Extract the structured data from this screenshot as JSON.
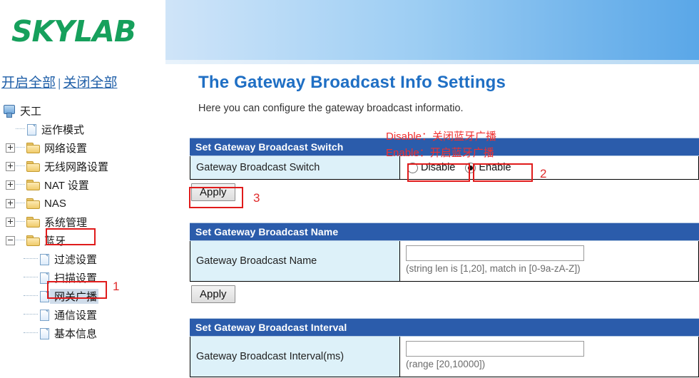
{
  "brand": {
    "logo_text": "SKYLAB"
  },
  "tree_links": {
    "expand_all": "开启全部",
    "separator": "|",
    "collapse_all": "关闭全部"
  },
  "sidebar": {
    "root": {
      "label": "天工",
      "icon": "computer-icon"
    },
    "items": [
      {
        "label": "运作模式",
        "icon": "document-icon",
        "type": "leaf",
        "expander": "none",
        "selected": false
      },
      {
        "label": "网络设置",
        "icon": "folder-icon",
        "type": "folder",
        "expander": "plus",
        "selected": false
      },
      {
        "label": "无线网路设置",
        "icon": "folder-icon",
        "type": "folder",
        "expander": "plus",
        "selected": false
      },
      {
        "label": "NAT 设置",
        "icon": "folder-icon",
        "type": "folder",
        "expander": "plus",
        "selected": false
      },
      {
        "label": "NAS",
        "icon": "folder-icon",
        "type": "folder",
        "expander": "plus",
        "selected": false
      },
      {
        "label": "系统管理",
        "icon": "folder-icon",
        "type": "folder",
        "expander": "plus",
        "selected": false
      },
      {
        "label": "蓝牙",
        "icon": "folder-icon",
        "type": "folder",
        "expander": "minus",
        "selected": false
      }
    ],
    "bluetooth_children": [
      {
        "label": "过滤设置",
        "icon": "document-icon",
        "selected": false
      },
      {
        "label": "扫描设置",
        "icon": "document-icon",
        "selected": false
      },
      {
        "label": "网关广播",
        "icon": "document-icon",
        "selected": true
      },
      {
        "label": "通信设置",
        "icon": "document-icon",
        "selected": false
      },
      {
        "label": "基本信息",
        "icon": "document-icon",
        "selected": false
      }
    ]
  },
  "main": {
    "title": "The Gateway Broadcast Info Settings",
    "description": "Here you can configure the gateway broadcast informatio."
  },
  "sections": {
    "switch": {
      "header": "Set Gateway Broadcast Switch",
      "label": "Gateway Broadcast Switch",
      "options": [
        {
          "label": "Disable",
          "selected": false
        },
        {
          "label": "Enable",
          "selected": true
        }
      ],
      "apply_label": "Apply"
    },
    "name": {
      "header": "Set Gateway Broadcast Name",
      "label": "Gateway Broadcast Name",
      "value": "",
      "hint": "(string len is [1,20], match in [0-9a-zA-Z])",
      "apply_label": "Apply"
    },
    "interval": {
      "header": "Set Gateway Broadcast Interval",
      "label": "Gateway Broadcast Interval(ms)",
      "value": "",
      "hint": "(range [20,10000])"
    }
  },
  "annotations": {
    "disable_note": "Disable：关闭蓝牙广播",
    "enable_note": "Enable：开启蓝牙广播",
    "num_1": "1",
    "num_2": "2",
    "num_3": "3"
  },
  "colors": {
    "brand_green": "#16a05c",
    "title_blue": "#1f6fc4",
    "section_header_blue": "#2b5cab",
    "label_cell_blue": "#ddf1f9",
    "annotation_red": "#e01b1b"
  }
}
